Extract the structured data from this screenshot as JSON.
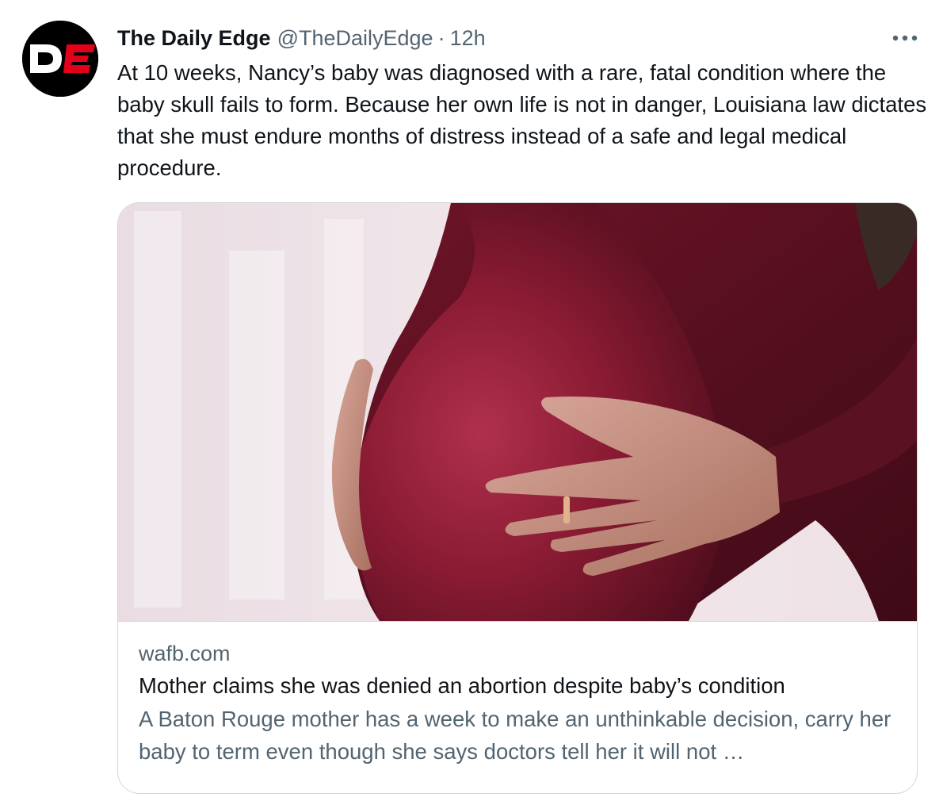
{
  "tweet": {
    "author_name": "The Daily Edge",
    "author_handle": "@TheDailyEdge",
    "separator": "·",
    "time": "12h",
    "text": "At 10 weeks, Nancy’s baby was diagnosed with a rare, fatal condition where the baby skull fails to form. Because her own life is not in danger, Louisiana law dictates that she must endure months of distress instead of a safe and legal medical procedure.",
    "avatar_letters": "DE"
  },
  "card": {
    "domain": "wafb.com",
    "title": "Mother claims she was denied an abortion despite baby’s condition",
    "description": "A Baton Rouge mother has a week to make an unthinkable decision, carry her baby to term even though she says doctors tell her it will not …"
  },
  "icons": {
    "more": "more-horizontal-icon"
  },
  "colors": {
    "text_primary": "#0f1419",
    "text_secondary": "#536471",
    "border": "#cfd9de",
    "avatar_red": "#e2001a"
  }
}
